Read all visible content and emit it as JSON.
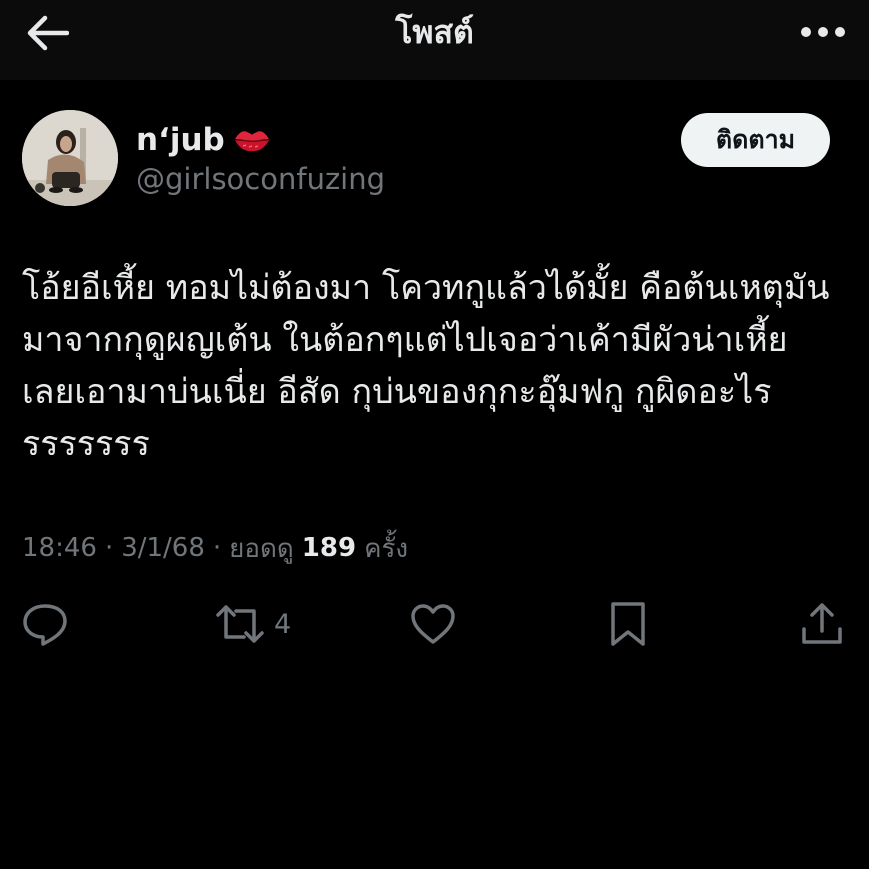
{
  "header": {
    "title": "โพสต์",
    "back_icon": "arrow-left-icon",
    "more_icon": "more-horizontal-icon"
  },
  "author": {
    "display_name": "n‘jub",
    "name_emoji": "lips-emoji",
    "handle": "@girlsoconfuzing",
    "follow_label": "ติดตาม"
  },
  "post": {
    "text": "โอ้ยอีเหี้ย ทอมไม่ต้องมา โควทกูแล้วได้มั้ย คือต้นเหตุมัน\nมาจากกุดูผญเต้น ในต้อกๆแต่ไปเจอว่าเค้ามีผัวน่าเหี้ย\nเลยเอามาบ่นเนี่ย อีสัด กุบ่นของกุกะอุ๊มฟกู กูผิดอะไร\nรรรรรรร",
    "time": "18:46",
    "date": "3/1/68",
    "views_label": "ยอดดู",
    "views_count": "189",
    "views_suffix": "ครั้ง"
  },
  "actions": {
    "reply_icon": "reply-icon",
    "repost_icon": "repost-icon",
    "repost_count": "4",
    "like_icon": "heart-icon",
    "bookmark_icon": "bookmark-icon",
    "share_icon": "share-icon"
  },
  "colors": {
    "background": "#000000",
    "header_bg": "#0b0b0b",
    "primary_text": "#e7e9ea",
    "secondary_text": "#71767b",
    "follow_button_bg": "#eff3f4"
  }
}
